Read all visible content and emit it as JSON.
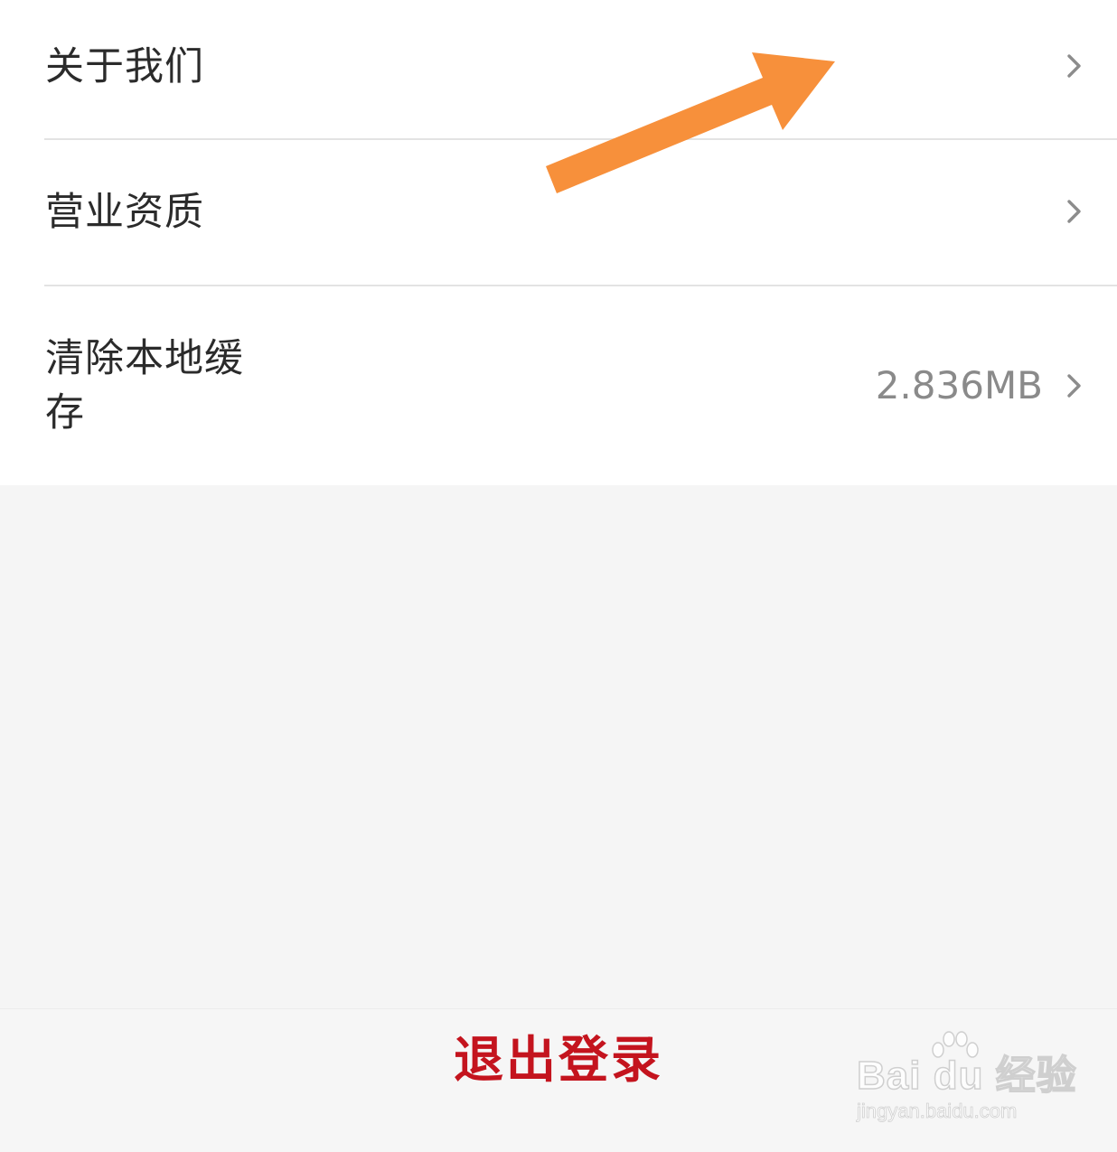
{
  "settings": {
    "items": [
      {
        "label": "关于我们",
        "icon": "chevron-right-icon"
      },
      {
        "label": "营业资质",
        "icon": "chevron-right-icon"
      },
      {
        "label": "清除本地缓存",
        "value": "2.836MB",
        "icon": "chevron-right-icon"
      }
    ]
  },
  "annotation": {
    "icon": "orange-arrow-annotation-icon",
    "color": "#f7903b"
  },
  "logout": {
    "label": "退出登录",
    "color": "#c4141e"
  },
  "watermark": {
    "brand": "Bai du 经验",
    "domain": "jingyan.baidu.com",
    "icon": "baidu-paw-icon"
  }
}
